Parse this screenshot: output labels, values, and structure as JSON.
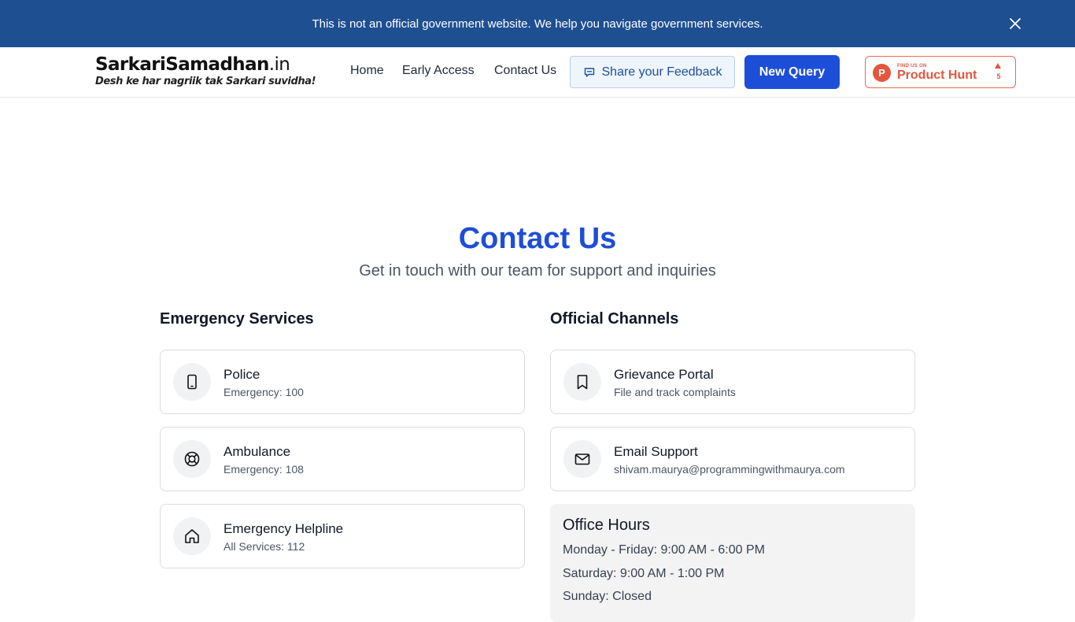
{
  "banner": {
    "text": "This is not an official government website. We help you navigate government services."
  },
  "logo": {
    "main": "SarkariSamadhan",
    "suffix": ".in",
    "tagline": "Desh ke har nagriik tak Sarkari suvidha!"
  },
  "nav": {
    "home": "Home",
    "early_access": "Early Access",
    "contact": "Contact Us",
    "feedback": "Share your Feedback",
    "new_query": "New Query"
  },
  "product_hunt": {
    "small": "FIND US ON",
    "name": "Product Hunt",
    "count": "5"
  },
  "page": {
    "title": "Contact Us",
    "subtitle": "Get in touch with our team for support and inquiries"
  },
  "emergency": {
    "heading": "Emergency Services",
    "items": [
      {
        "title": "Police",
        "sub": "Emergency: 100",
        "icon": "phone-icon"
      },
      {
        "title": "Ambulance",
        "sub": "Emergency: 108",
        "icon": "lifebuoy-icon"
      },
      {
        "title": "Emergency Helpline",
        "sub": "All Services: 112",
        "icon": "home-icon"
      }
    ]
  },
  "official": {
    "heading": "Official Channels",
    "items": [
      {
        "title": "Grievance Portal",
        "sub": "File and track complaints",
        "icon": "bookmark-icon"
      },
      {
        "title": "Email Support",
        "sub": "shivam.maurya@programmingwithmaurya.com",
        "icon": "mail-icon"
      }
    ]
  },
  "office_hours": {
    "title": "Office Hours",
    "weekdays": "Monday - Friday: 9:00 AM - 6:00 PM",
    "saturday": "Saturday: 9:00 AM - 1:00 PM",
    "sunday": "Sunday: Closed"
  },
  "colors": {
    "banner": "#1e4f91",
    "primary": "#1d4ed8",
    "product_hunt": "#e3553e"
  }
}
